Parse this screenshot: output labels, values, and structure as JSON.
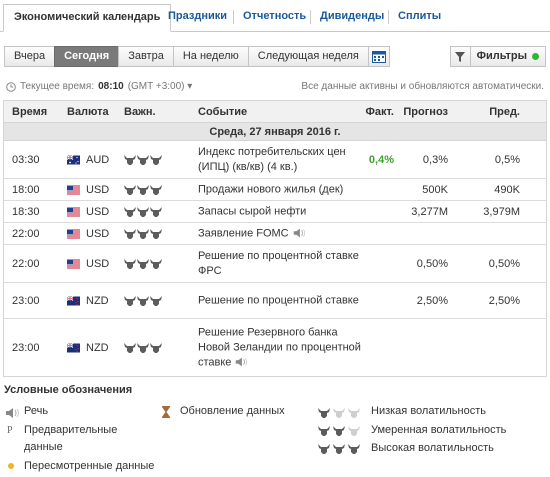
{
  "tabs": {
    "active": "Экономический календарь",
    "items": [
      "Праздники",
      "Отчетность",
      "Дивиденды",
      "Сплиты"
    ]
  },
  "period_buttons": [
    "Вчера",
    "Сегодня",
    "Завтра",
    "На неделю",
    "Следующая неделя"
  ],
  "period_active": "Сегодня",
  "filters_label": "Фильтры",
  "time_bar": {
    "label": "Текущее время:",
    "time": "08:10",
    "tz": "(GMT +3:00)",
    "note": "Все данные активны и обновляются автоматически."
  },
  "table": {
    "headers": {
      "time": "Время",
      "currency": "Валюта",
      "importance": "Важн.",
      "event": "Событие",
      "actual": "Факт.",
      "forecast": "Прогноз",
      "previous": "Пред."
    },
    "day": "Среда, 27 января 2016 г.",
    "rows": [
      {
        "time": "03:30",
        "currency": "AUD",
        "flag": "au",
        "importance": 3,
        "event": "Индекс потребительских цен (ИПЦ) (кв/кв) (4 кв.)",
        "speech": false,
        "actual": "0,4%",
        "forecast": "0,3%",
        "previous": "0,5%"
      },
      {
        "time": "18:00",
        "currency": "USD",
        "flag": "us",
        "importance": 3,
        "event": "Продажи нового жилья (дек)",
        "speech": false,
        "actual": "",
        "forecast": "500K",
        "previous": "490K"
      },
      {
        "time": "18:30",
        "currency": "USD",
        "flag": "us",
        "importance": 3,
        "event": "Запасы сырой нефти",
        "speech": false,
        "actual": "",
        "forecast": "3,277M",
        "previous": "3,979M"
      },
      {
        "time": "22:00",
        "currency": "USD",
        "flag": "us",
        "importance": 3,
        "event": "Заявление FOMC",
        "speech": true,
        "actual": "",
        "forecast": "",
        "previous": ""
      },
      {
        "time": "22:00",
        "currency": "USD",
        "flag": "us",
        "importance": 3,
        "event": "Решение по процентной ставке ФРС",
        "speech": false,
        "actual": "",
        "forecast": "0,50%",
        "previous": "0,50%"
      },
      {
        "time": "23:00",
        "currency": "NZD",
        "flag": "nz",
        "importance": 3,
        "event": "Решение по процентной ставке",
        "speech": false,
        "actual": "",
        "forecast": "2,50%",
        "previous": "2,50%"
      },
      {
        "time": "23:00",
        "currency": "NZD",
        "flag": "nz",
        "importance": 3,
        "event": "Решение Резервного банка Новой Зеландии по процентной ставке",
        "speech": true,
        "actual": "",
        "forecast": "",
        "previous": ""
      }
    ]
  },
  "legend": {
    "title": "Условные обозначения",
    "speech": "Речь",
    "preliminary": "Предварительные данные",
    "preliminary_mark": "P",
    "revised": "Пересмотренные данные",
    "update": "Обновление данных",
    "low": "Низкая волатильность",
    "medium": "Умеренная волатильность",
    "high": "Высокая волатильность"
  },
  "colors": {
    "accent_link": "#1a5a9a",
    "actual_green": "#3aa12d",
    "active_button": "#7a7a7a",
    "revised_dot": "#f0b429",
    "bull_dark": "#5c5c5c",
    "bull_light": "#cfcfcf"
  }
}
